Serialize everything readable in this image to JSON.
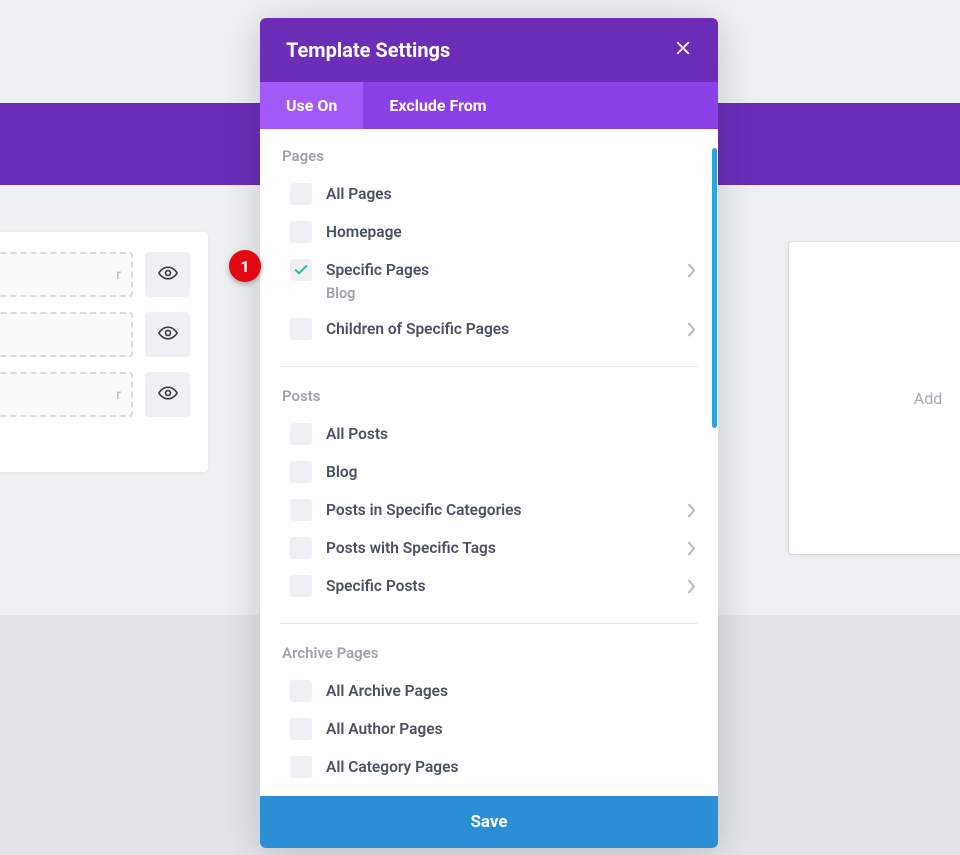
{
  "modal": {
    "title": "Template Settings",
    "tabs": [
      {
        "label": "Use On",
        "active": true
      },
      {
        "label": "Exclude From",
        "active": false
      }
    ],
    "sections": [
      {
        "header": "Pages",
        "items": [
          {
            "label": "All Pages",
            "checked": false,
            "expandable": false
          },
          {
            "label": "Homepage",
            "checked": false,
            "expandable": false
          },
          {
            "label": "Specific Pages",
            "checked": true,
            "expandable": true,
            "sublabel": "Blog"
          },
          {
            "label": "Children of Specific Pages",
            "checked": false,
            "expandable": true
          }
        ]
      },
      {
        "header": "Posts",
        "items": [
          {
            "label": "All Posts",
            "checked": false,
            "expandable": false
          },
          {
            "label": "Blog",
            "checked": false,
            "expandable": false
          },
          {
            "label": "Posts in Specific Categories",
            "checked": false,
            "expandable": true
          },
          {
            "label": "Posts with Specific Tags",
            "checked": false,
            "expandable": true
          },
          {
            "label": "Specific Posts",
            "checked": false,
            "expandable": true
          }
        ]
      },
      {
        "header": "Archive Pages",
        "items": [
          {
            "label": "All Archive Pages",
            "checked": false,
            "expandable": false
          },
          {
            "label": "All Author Pages",
            "checked": false,
            "expandable": false
          },
          {
            "label": "All Category Pages",
            "checked": false,
            "expandable": false
          }
        ]
      }
    ],
    "save": "Save"
  },
  "left_card": {
    "rows": [
      {
        "text": "r"
      },
      {
        "text": ""
      },
      {
        "text": "r"
      }
    ]
  },
  "right_card": {
    "label": "Add"
  },
  "annotation": {
    "badge": "1"
  }
}
